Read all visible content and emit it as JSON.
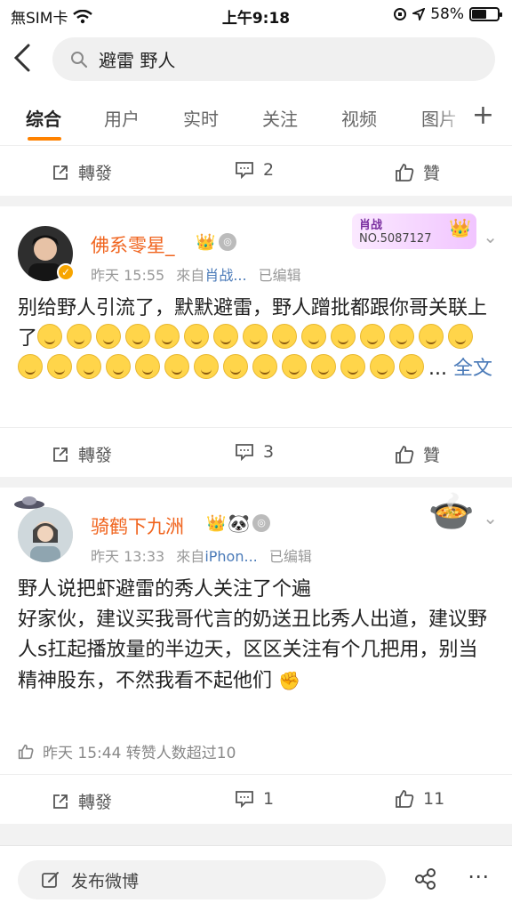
{
  "status": {
    "carrier": "無SIM卡",
    "time": "上午9:18",
    "battery": "58%",
    "battery_level": 0.58
  },
  "search": {
    "query": "避雷 野人"
  },
  "tabs": [
    {
      "label": "综合",
      "active": true
    },
    {
      "label": "用户"
    },
    {
      "label": "实时"
    },
    {
      "label": "关注"
    },
    {
      "label": "视频"
    },
    {
      "label": "图片"
    }
  ],
  "top_actions": {
    "repost": "轉發",
    "comments": "2",
    "like": "贊"
  },
  "post1": {
    "username": "佛系零星_",
    "time": "昨天 15:55",
    "source_prefix": "來自",
    "source": "肖战...",
    "edited": "已编辑",
    "badge_title": "肖战",
    "badge_number": "NO.5087127",
    "text": "别给野人引流了，默默避雷，野人蹭批都跟你哥关联上了",
    "emoji_count": 29,
    "more": "...",
    "fulltext": "全文",
    "actions": {
      "repost": "轉發",
      "comments": "3",
      "like": "贊"
    }
  },
  "post2": {
    "username": "骑鹤下九洲",
    "time": "昨天 13:33",
    "source_prefix": "來自",
    "source": "iPhon...",
    "edited": "已编辑",
    "lines": [
      "野人说把虾避雷的秀人关注了个遍",
      "好家伙，建议买我哥代言的奶送丑比秀人出道，建议野人s扛起播放量的半边天，区区关注有个几把用，别当精神股东，不然我看不起他们"
    ],
    "like_info": "昨天 15:44 转赞人数超过10",
    "actions": {
      "repost": "轉發",
      "comments": "1",
      "likes": "11"
    }
  },
  "bottom": {
    "compose": "发布微博"
  },
  "colors": {
    "accent": "#ff8200",
    "username": "#f0641e",
    "link": "#4a7ab8"
  }
}
